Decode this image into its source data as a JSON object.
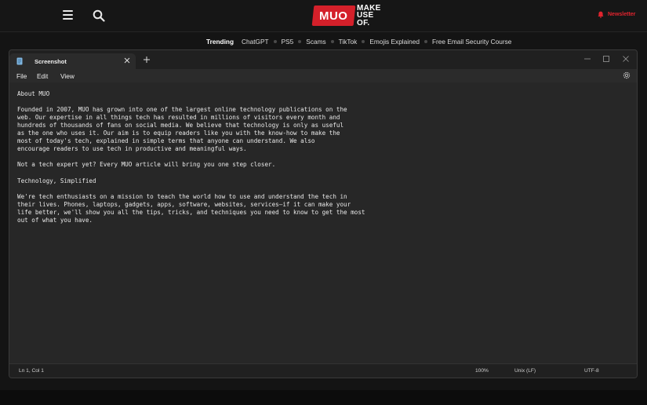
{
  "site": {
    "logo_mark": "MUO",
    "logo_words": [
      "MAKE",
      "USE",
      "OF."
    ],
    "newsletter_label": "Newsletter",
    "accent_color": "#d4202a"
  },
  "trending": {
    "label": "Trending",
    "items": [
      "ChatGPT",
      "PS5",
      "Scams",
      "TikTok",
      "Emojis Explained",
      "Free Email Security Course"
    ]
  },
  "window": {
    "tab_title": "Screenshot",
    "menu": [
      "File",
      "Edit",
      "View"
    ],
    "content": "About MUO\n\nFounded in 2007, MUO has grown into one of the largest online technology publications on the\nweb. Our expertise in all things tech has resulted in millions of visitors every month and\nhundreds of thousands of fans on social media. We believe that technology is only as useful\nas the one who uses it. Our aim is to equip readers like you with the know-how to make the\nmost of today's tech, explained in simple terms that anyone can understand. We also\nencourage readers to use tech in productive and meaningful ways.\n\nNot a tech expert yet? Every MUO article will bring you one step closer.\n\nTechnology, Simplified\n\nWe're tech enthusiasts on a mission to teach the world how to use and understand the tech in\ntheir lives. Phones, laptops, gadgets, apps, software, websites, services—if it can make your\nlife better, we'll show you all the tips, tricks, and techniques you need to know to get the most\nout of what you have.",
    "status": {
      "position": "Ln 1, Col 1",
      "zoom": "100%",
      "line_ending": "Unix (LF)",
      "encoding": "UTF-8"
    }
  },
  "icons": {
    "menu": "hamburger-icon",
    "search": "search-icon",
    "bell": "bell-icon",
    "notepad": "notepad-icon",
    "close": "close-icon",
    "add": "plus-icon",
    "minimize": "minimize-icon",
    "maximize": "maximize-icon",
    "settings": "gear-icon"
  }
}
